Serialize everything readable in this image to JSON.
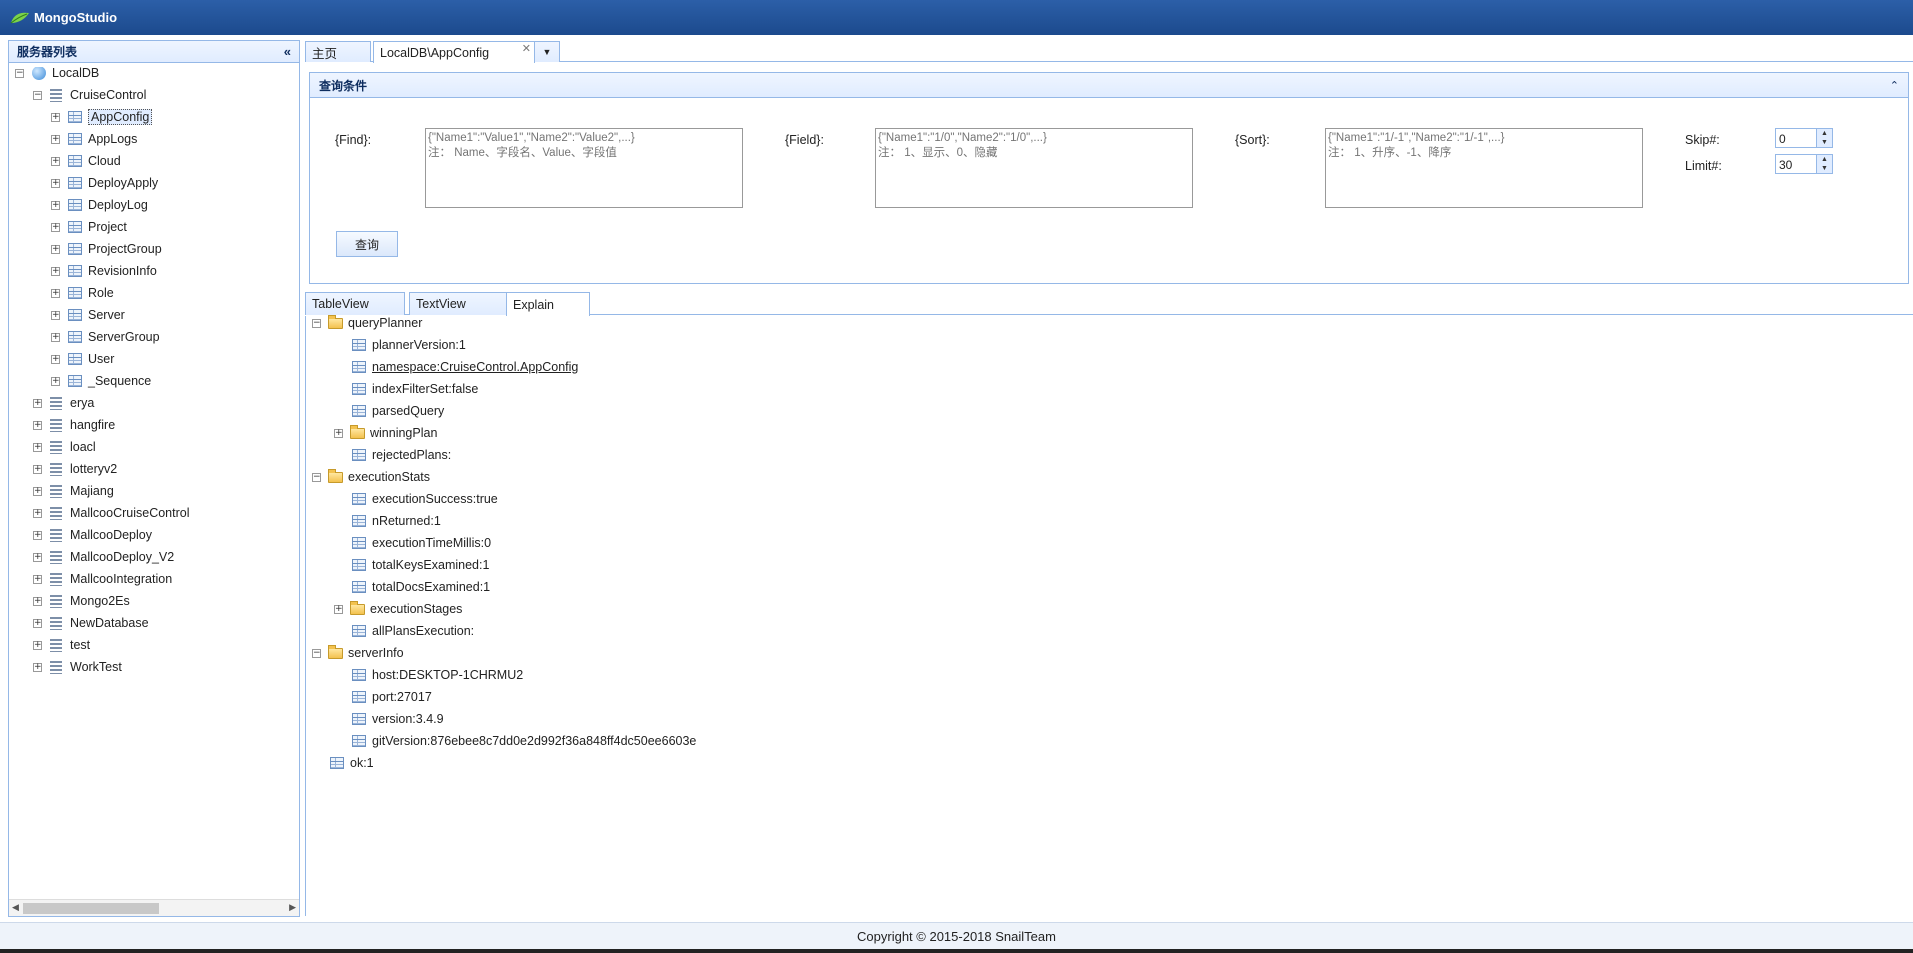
{
  "app": {
    "title": "MongoStudio"
  },
  "left": {
    "title": "服务器列表",
    "tree": [
      {
        "label": "LocalDB",
        "level": 0,
        "icon": "server",
        "expanded": true
      },
      {
        "label": "CruiseControl",
        "level": 1,
        "icon": "database",
        "expanded": true
      },
      {
        "label": "AppConfig",
        "level": 2,
        "icon": "collection",
        "selected": true
      },
      {
        "label": "AppLogs",
        "level": 2,
        "icon": "collection"
      },
      {
        "label": "Cloud",
        "level": 2,
        "icon": "collection"
      },
      {
        "label": "DeployApply",
        "level": 2,
        "icon": "collection"
      },
      {
        "label": "DeployLog",
        "level": 2,
        "icon": "collection"
      },
      {
        "label": "Project",
        "level": 2,
        "icon": "collection"
      },
      {
        "label": "ProjectGroup",
        "level": 2,
        "icon": "collection"
      },
      {
        "label": "RevisionInfo",
        "level": 2,
        "icon": "collection"
      },
      {
        "label": "Role",
        "level": 2,
        "icon": "collection"
      },
      {
        "label": "Server",
        "level": 2,
        "icon": "collection"
      },
      {
        "label": "ServerGroup",
        "level": 2,
        "icon": "collection"
      },
      {
        "label": "User",
        "level": 2,
        "icon": "collection"
      },
      {
        "label": "_Sequence",
        "level": 2,
        "icon": "collection"
      },
      {
        "label": "erya",
        "level": 1,
        "icon": "database"
      },
      {
        "label": "hangfire",
        "level": 1,
        "icon": "database"
      },
      {
        "label": "loacl",
        "level": 1,
        "icon": "database"
      },
      {
        "label": "lotteryv2",
        "level": 1,
        "icon": "database"
      },
      {
        "label": "Majiang",
        "level": 1,
        "icon": "database"
      },
      {
        "label": "MallcooCruiseControl",
        "level": 1,
        "icon": "database"
      },
      {
        "label": "MallcooDeploy",
        "level": 1,
        "icon": "database"
      },
      {
        "label": "MallcooDeploy_V2",
        "level": 1,
        "icon": "database"
      },
      {
        "label": "MallcooIntegration",
        "level": 1,
        "icon": "database"
      },
      {
        "label": "Mongo2Es",
        "level": 1,
        "icon": "database"
      },
      {
        "label": "NewDatabase",
        "level": 1,
        "icon": "database"
      },
      {
        "label": "test",
        "level": 1,
        "icon": "database"
      },
      {
        "label": "WorkTest",
        "level": 1,
        "icon": "database"
      }
    ]
  },
  "tabs": {
    "home": "主页",
    "current": "LocalDB\\AppConfig"
  },
  "query": {
    "title": "查询条件",
    "find_label": "{Find}:",
    "find_placeholder": "{\"Name1\":\"Value1\",\"Name2\":\"Value2\",...}\n注： Name、字段名、Value、字段值",
    "field_label": "{Field}:",
    "field_placeholder": "{\"Name1\":\"1/0\",\"Name2\":\"1/0\",...}\n注： 1、显示、0、隐藏",
    "sort_label": "{Sort}:",
    "sort_placeholder": "{\"Name1\":\"1/-1\",\"Name2\":\"1/-1\",...}\n注： 1、升序、-1、降序",
    "skip_label": "Skip#:",
    "skip_value": "0",
    "limit_label": "Limit#:",
    "limit_value": "30",
    "button": "查询"
  },
  "result_tabs": [
    "TableView",
    "TextView",
    "Explain"
  ],
  "explain": [
    {
      "label": "queryPlanner",
      "level": 0,
      "icon": "folder",
      "expanded": true
    },
    {
      "label": "plannerVersion:1",
      "level": 1,
      "icon": "field"
    },
    {
      "label": "namespace:CruiseControl.AppConfig",
      "level": 1,
      "icon": "field",
      "underline": true
    },
    {
      "label": "indexFilterSet:false",
      "level": 1,
      "icon": "field"
    },
    {
      "label": "parsedQuery",
      "level": 1,
      "icon": "field"
    },
    {
      "label": "winningPlan",
      "level": 1,
      "icon": "folder",
      "expanded": false
    },
    {
      "label": "rejectedPlans:",
      "level": 1,
      "icon": "field"
    },
    {
      "label": "executionStats",
      "level": 0,
      "icon": "folder",
      "expanded": true
    },
    {
      "label": "executionSuccess:true",
      "level": 1,
      "icon": "field"
    },
    {
      "label": "nReturned:1",
      "level": 1,
      "icon": "field"
    },
    {
      "label": "executionTimeMillis:0",
      "level": 1,
      "icon": "field"
    },
    {
      "label": "totalKeysExamined:1",
      "level": 1,
      "icon": "field"
    },
    {
      "label": "totalDocsExamined:1",
      "level": 1,
      "icon": "field"
    },
    {
      "label": "executionStages",
      "level": 1,
      "icon": "folder",
      "expanded": false
    },
    {
      "label": "allPlansExecution:",
      "level": 1,
      "icon": "field"
    },
    {
      "label": "serverInfo",
      "level": 0,
      "icon": "folder",
      "expanded": true
    },
    {
      "label": "host:DESKTOP-1CHRMU2",
      "level": 1,
      "icon": "field"
    },
    {
      "label": "port:27017",
      "level": 1,
      "icon": "field"
    },
    {
      "label": "version:3.4.9",
      "level": 1,
      "icon": "field"
    },
    {
      "label": "gitVersion:876ebee8c7dd0e2d992f36a848ff4dc50ee6603e",
      "level": 1,
      "icon": "field"
    },
    {
      "label": "ok:1",
      "level": 0,
      "icon": "field"
    }
  ],
  "footer": "Copyright © 2015-2018 SnailTeam"
}
